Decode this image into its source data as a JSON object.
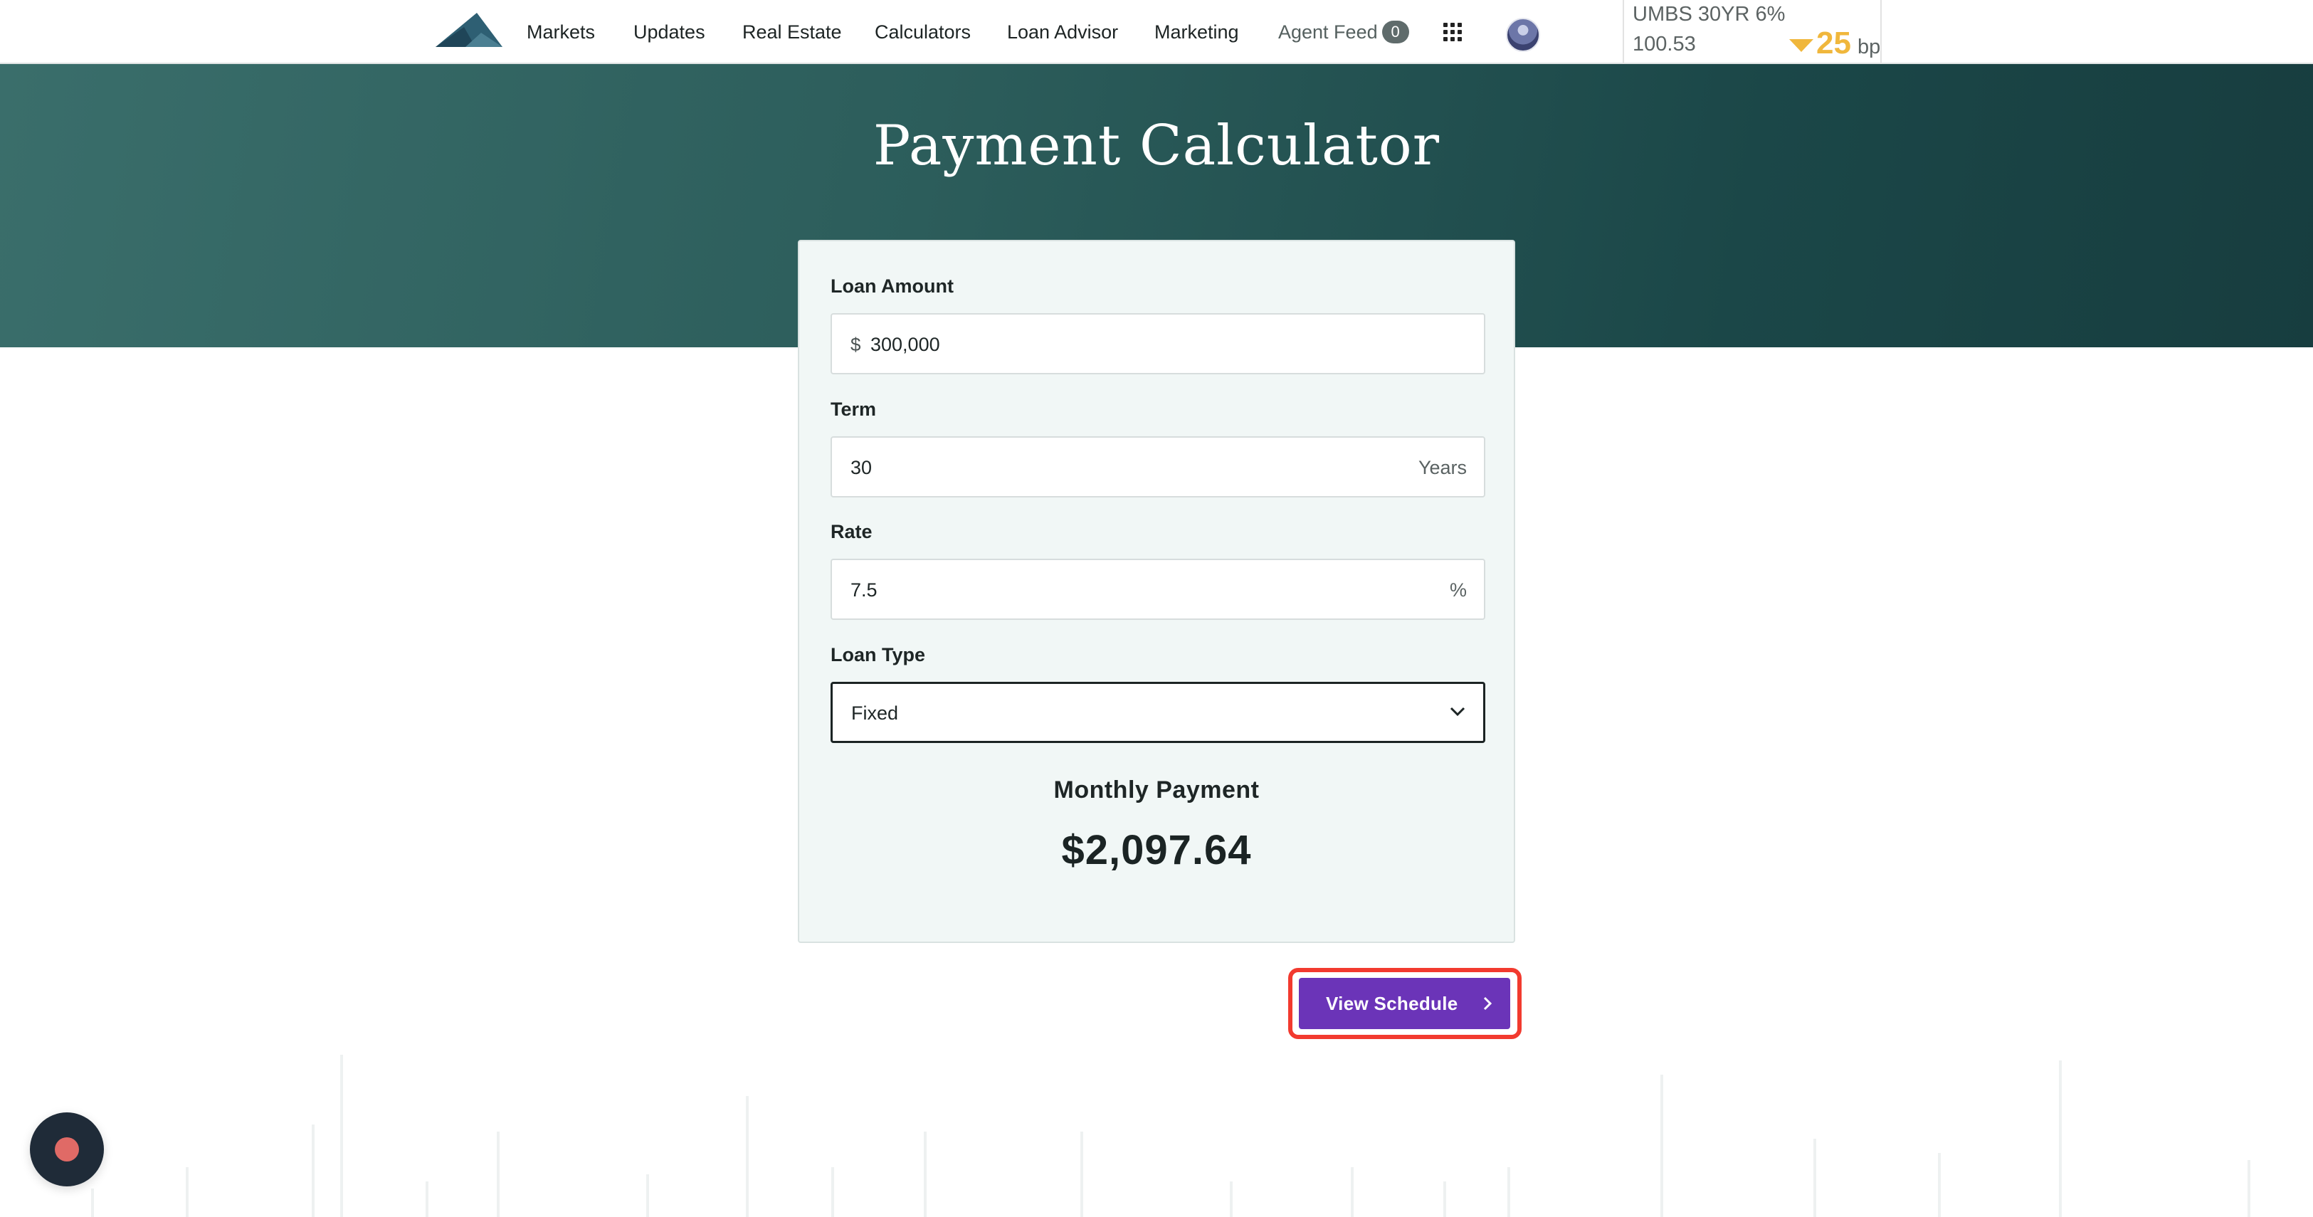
{
  "nav": {
    "items": [
      "Markets",
      "Updates",
      "Real Estate",
      "Calculators",
      "Loan Advisor",
      "Marketing"
    ],
    "agent_feed": {
      "label": "Agent Feed",
      "count": "0"
    },
    "icons": [
      "mountain-logo",
      "apps-grid-icon",
      "avatar"
    ]
  },
  "ticker": {
    "label": "UMBS 30YR 6%",
    "price": "100.53",
    "change": "25",
    "unit": "bp",
    "direction": "down",
    "color": "#f0b73c"
  },
  "hero": {
    "title": "Payment Calculator"
  },
  "form": {
    "loan_amount": {
      "label": "Loan Amount",
      "prefix": "$",
      "value": "300,000"
    },
    "term": {
      "label": "Term",
      "value": "30",
      "suffix": "Years"
    },
    "rate": {
      "label": "Rate",
      "value": "7.5",
      "suffix": "%"
    },
    "loan_type": {
      "label": "Loan Type",
      "value": "Fixed"
    }
  },
  "result": {
    "label": "Monthly Payment",
    "value": "$2,097.64"
  },
  "actions": {
    "view_schedule": "View Schedule"
  },
  "colors": {
    "hero": "#2c5d5b",
    "button": "#6b34b8",
    "highlight": "#f23a2f",
    "chat": "#1f2b38"
  }
}
